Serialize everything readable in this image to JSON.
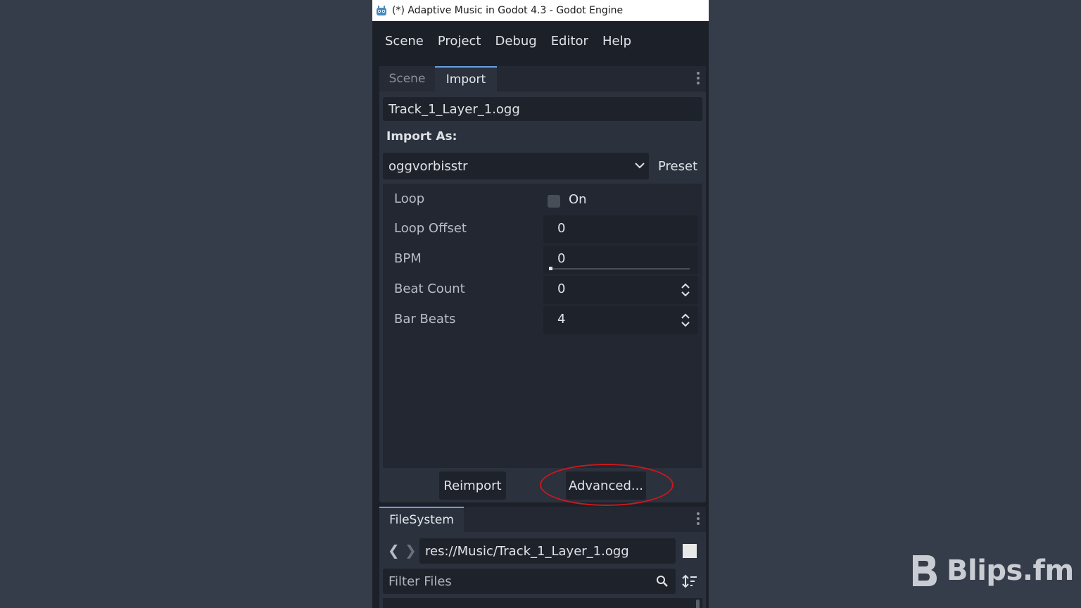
{
  "window": {
    "title": "(*) Adaptive Music in Godot 4.3 - Godot Engine"
  },
  "menubar": {
    "items": [
      "Scene",
      "Project",
      "Debug",
      "Editor",
      "Help"
    ]
  },
  "dock": {
    "tabs": [
      {
        "label": "Scene",
        "active": false
      },
      {
        "label": "Import",
        "active": true
      }
    ],
    "file_name": "Track_1_Layer_1.ogg",
    "import_as_label": "Import As:",
    "importer": "oggvorbisstr",
    "preset_label": "Preset",
    "properties": [
      {
        "label": "Loop",
        "value": "On",
        "type": "checkbox",
        "checked": false
      },
      {
        "label": "Loop Offset",
        "value": "0",
        "type": "number"
      },
      {
        "label": "BPM",
        "value": "0",
        "type": "slider"
      },
      {
        "label": "Beat Count",
        "value": "0",
        "type": "spinbox"
      },
      {
        "label": "Bar Beats",
        "value": "4",
        "type": "spinbox"
      }
    ],
    "reimport_label": "Reimport",
    "advanced_label": "Advanced..."
  },
  "filesystem": {
    "tab_label": "FileSystem",
    "path": "res://Music/Track_1_Layer_1.ogg",
    "filter_placeholder": "Filter Files"
  },
  "watermark": {
    "text": "Blips.fm"
  },
  "colors": {
    "accent": "#6aa0e0",
    "highlight_ring": "#c8191e",
    "background": "#363d4a"
  }
}
